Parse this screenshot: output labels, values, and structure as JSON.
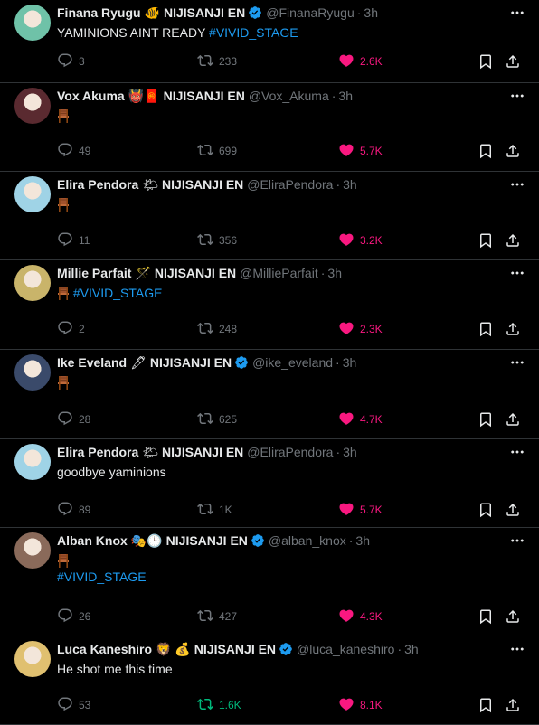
{
  "tweets": [
    {
      "name": "Finana Ryugu",
      "emoji": "🐠",
      "affiliation": "NIJISANJI EN",
      "verified": true,
      "handle": "@FinanaRyugu",
      "time": "3h",
      "text": "YAMINIONS AINT READY ",
      "hashtag": "#VIVID_STAGE",
      "replies": "3",
      "retweets": "233",
      "likes": "2.6K",
      "retweeted": false,
      "avatar_color": "#6fc2a8"
    },
    {
      "name": "Vox Akuma",
      "emoji": "👹🧧",
      "affiliation": "NIJISANJI EN",
      "verified": false,
      "handle": "@Vox_Akuma",
      "time": "3h",
      "text": "",
      "hashtag": "",
      "replies": "49",
      "retweets": "699",
      "likes": "5.7K",
      "retweeted": false,
      "avatar_color": "#5a2a30"
    },
    {
      "name": "Elira Pendora",
      "emoji": "🌤",
      "affiliation": "NIJISANJI EN",
      "verified": false,
      "handle": "@EliraPendora",
      "time": "3h",
      "text": "",
      "hashtag": "",
      "replies": "11",
      "retweets": "356",
      "likes": "3.2K",
      "retweeted": false,
      "avatar_color": "#9fd3e6"
    },
    {
      "name": "Millie Parfait",
      "emoji": "🪄",
      "affiliation": "NIJISANJI EN",
      "verified": false,
      "handle": "@MillieParfait",
      "time": "3h",
      "text": "",
      "hashtag": "#VIVID_STAGE",
      "replies": "2",
      "retweets": "248",
      "likes": "2.3K",
      "retweeted": false,
      "avatar_color": "#c9b46a"
    },
    {
      "name": "Ike Eveland",
      "emoji": "🖋",
      "affiliation": "NIJISANJI EN",
      "verified": true,
      "handle": "@ike_eveland",
      "time": "3h",
      "text": "",
      "hashtag": "",
      "replies": "28",
      "retweets": "625",
      "likes": "4.7K",
      "retweeted": false,
      "avatar_color": "#3a4a6a"
    },
    {
      "name": "Elira Pendora",
      "emoji": "🌤",
      "affiliation": "NIJISANJI EN",
      "verified": false,
      "handle": "@EliraPendora",
      "time": "3h",
      "text": "goodbye yaminions",
      "hashtag": "",
      "replies": "89",
      "retweets": "1K",
      "likes": "5.7K",
      "retweeted": false,
      "avatar_color": "#9fd3e6"
    },
    {
      "name": "Alban Knox",
      "emoji": "🎭🕒",
      "affiliation": "NIJISANJI EN",
      "verified": true,
      "handle": "@alban_knox",
      "time": "3h",
      "text": "",
      "hashtag": "#VIVID_STAGE",
      "replies": "26",
      "retweets": "427",
      "likes": "4.3K",
      "retweeted": false,
      "avatar_color": "#8a6a5a"
    },
    {
      "name": "Luca Kaneshiro",
      "emoji": "🦁 💰",
      "affiliation": "NIJISANJI EN",
      "verified": true,
      "handle": "@luca_kaneshiro",
      "time": "3h",
      "text": "He shot me this time",
      "hashtag": "",
      "replies": "53",
      "retweets": "1.6K",
      "likes": "8.1K",
      "retweeted": true,
      "avatar_color": "#e0c070"
    }
  ],
  "icons": {
    "reply": "reply-icon",
    "retweet": "retweet-icon",
    "like": "heart-icon",
    "bookmark": "bookmark-icon",
    "share": "share-icon",
    "more": "more-icon",
    "verified": "verified-badge-icon",
    "chair": "chair-emoji-icon"
  },
  "colors": {
    "accent": "#1d9bf0",
    "like": "#f91880",
    "retweet_active": "#00ba7c",
    "muted": "#71767b",
    "divider": "#2f3336"
  }
}
